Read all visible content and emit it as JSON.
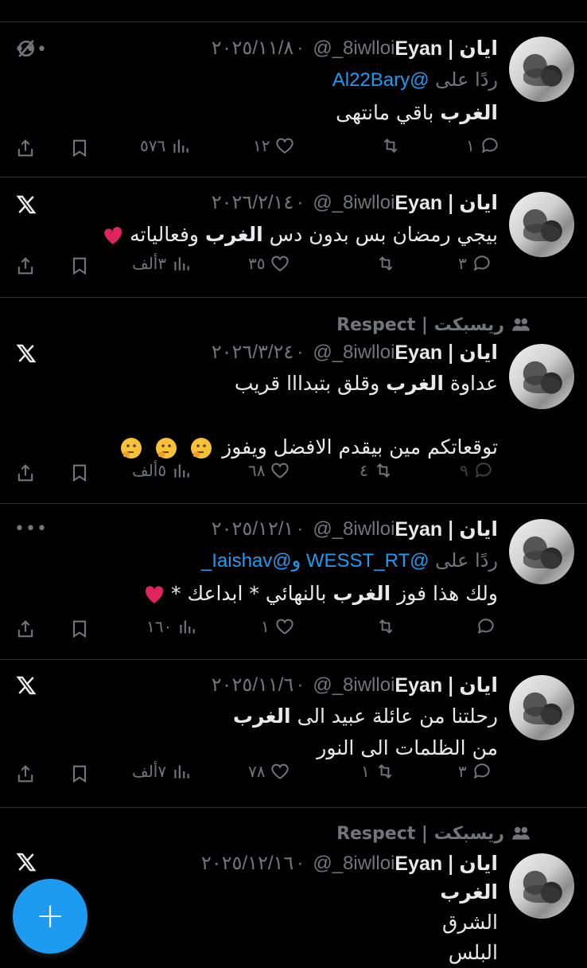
{
  "tweets": [
    {
      "name": "ايان",
      "bar": "|",
      "en": "Eyan",
      "handle": "@_8iwlloi",
      "date": "٢٠٢٥/١١/٨",
      "reply_prefix": "ردًا على",
      "reply_mentions": "@Al22Bary",
      "lines": [
        "<b>الغرب</b> باقي مانتهى"
      ],
      "replies": "١",
      "reposts": "",
      "likes": "١٢",
      "views": "٥٧٦",
      "top_icon": "hidden-reply-icon"
    },
    {
      "name": "ايان",
      "bar": "|",
      "en": "Eyan",
      "handle": "@_8iwlloi",
      "date": "٢٠٢٦/٢/١٤",
      "lines": [
        "بيجي رمضان بس بدون دس <b>الغرب</b> وفعالياته"
      ],
      "replies": "٣",
      "reposts": "",
      "likes": "٣٥",
      "views": "٣ألف",
      "top_icon": "x-logo-icon"
    },
    {
      "repost_by": "Respect | ريسبكت",
      "name": "ايان",
      "bar": "|",
      "en": "Eyan",
      "handle": "@_8iwlloi",
      "date": "٢٠٢٦/٣/٢٤",
      "lines": [
        "عداوة <b>الغرب</b> وقلق بتبدااا قريب",
        "",
        "توقعاتكم مين بيقدم الافضل ويفوز"
      ],
      "replies": "٩",
      "reposts": "٤",
      "likes": "٦٨",
      "views": "٥ألف",
      "top_icon": "x-logo-icon"
    },
    {
      "name": "ايان",
      "bar": "|",
      "en": "Eyan",
      "handle": "@_8iwlloi",
      "date": "٢٠٢٥/١٢/١",
      "reply_prefix": "ردًا على",
      "reply_mentions": "@WESST_RT و@Iaishav_",
      "lines": [
        "ولك هذا فوز <b>الغرب</b> بالنهائي * ابداعك *"
      ],
      "replies": "",
      "reposts": "",
      "likes": "١",
      "views": "١٦٠",
      "top_icon": "more-icon"
    },
    {
      "name": "ايان",
      "bar": "|",
      "en": "Eyan",
      "handle": "@_8iwlloi",
      "date": "٢٠٢٥/١١/٦",
      "lines": [
        "رحلتنا من عائلة عبيد الى <b>الغرب</b>",
        "من الظلمات الى النور"
      ],
      "replies": "٣",
      "reposts": "١",
      "likes": "٧٨",
      "views": "٧ألف",
      "top_icon": "x-logo-icon"
    },
    {
      "repost_by": "Respect | ريسبكت",
      "name": "ايان",
      "bar": "|",
      "en": "Eyan",
      "handle": "@_8iwlloi",
      "date": "٢٠٢٥/١٢/١٦",
      "lines": [
        "<b>الغرب</b>",
        "الشرق",
        "البلس"
      ],
      "top_icon": "x-logo-icon"
    }
  ],
  "separator_dot": "·",
  "more_text": "•••",
  "fab_symbol": "+",
  "colors": {
    "accent": "#1d9bf0",
    "background": "#000000",
    "muted": "#71767b",
    "text": "#e7e9ea"
  }
}
